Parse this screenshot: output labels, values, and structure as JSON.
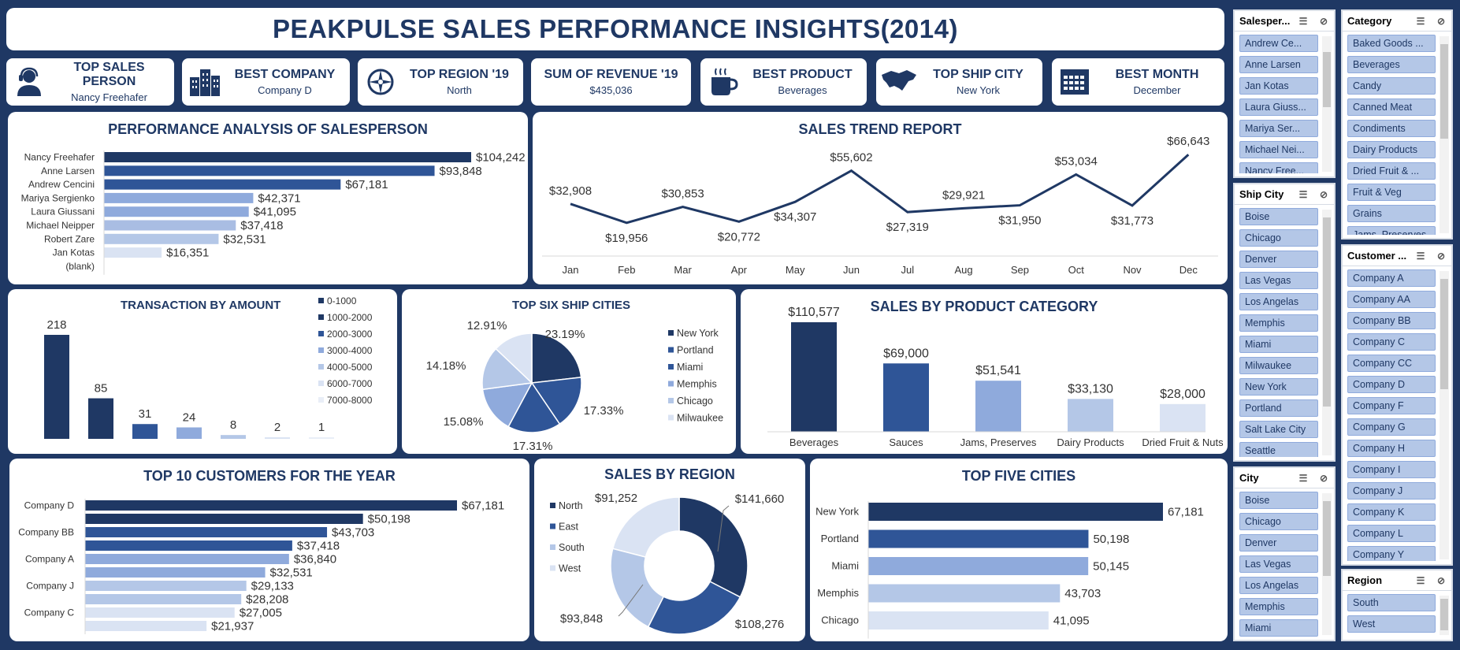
{
  "title": "PEAKPULSE SALES PERFORMANCE INSIGHTS(2014)",
  "kpis": [
    {
      "label": "TOP SALES PERSON",
      "value": "Nancy Freehafer",
      "icon": "person-headset-icon"
    },
    {
      "label": "BEST COMPANY",
      "value": "Company D",
      "icon": "buildings-icon"
    },
    {
      "label": "TOP REGION '19",
      "value": "North",
      "icon": "compass-icon"
    },
    {
      "label": "SUM OF REVENUE '19",
      "value": "$435,036",
      "icon": ""
    },
    {
      "label": "BEST PRODUCT",
      "value": "Beverages",
      "icon": "coffee-cup-icon"
    },
    {
      "label": "TOP SHIP CITY",
      "value": "New York",
      "icon": "map-icon"
    },
    {
      "label": "BEST MONTH",
      "value": "December",
      "icon": "calendar-icon"
    }
  ],
  "panels": {
    "salesperson": "PERFORMANCE ANALYSIS OF SALESPERSON",
    "trend": "SALES TREND REPORT",
    "transaction": "TRANSACTION BY AMOUNT",
    "ship": "TOP SIX SHIP CITIES",
    "category": "SALES BY PRODUCT CATEGORY",
    "customers": "TOP 10 CUSTOMERS FOR THE YEAR",
    "region": "SALES BY REGION",
    "cities": "TOP FIVE CITIES"
  },
  "colors": {
    "navy": "#1f3864",
    "blue": "#2f5597",
    "mid": "#8faadc",
    "light": "#b4c7e7",
    "pale": "#dae3f3",
    "bg": "#1f3864"
  },
  "chart_data": [
    {
      "id": "salesperson",
      "type": "bar",
      "orientation": "horizontal",
      "categories": [
        "Nancy Freehafer",
        "Anne Larsen",
        "Andrew Cencini",
        "Mariya Sergienko",
        "Laura Giussani",
        "Michael Neipper",
        "Robert Zare",
        "Jan Kotas",
        "(blank)"
      ],
      "values": [
        104242,
        93848,
        67181,
        42371,
        41095,
        37418,
        32531,
        16351,
        null
      ],
      "labels": [
        "$104,242",
        "$93,848",
        "$67,181",
        "$42,371",
        "$41,095",
        "$37,418",
        "$32,531",
        "$16,351",
        ""
      ],
      "colors": [
        "#1f3864",
        "#2f5597",
        "#2f5597",
        "#8faadc",
        "#8faadc",
        "#a9bde3",
        "#b4c7e7",
        "#dae3f3",
        "#ffffff"
      ]
    },
    {
      "id": "trend",
      "type": "line",
      "categories": [
        "Jan",
        "Feb",
        "Mar",
        "Apr",
        "May",
        "Jun",
        "Jul",
        "Aug",
        "Sep",
        "Oct",
        "Nov",
        "Dec"
      ],
      "values": [
        32908,
        19956,
        30853,
        20772,
        34307,
        55602,
        27319,
        29921,
        31950,
        53034,
        31773,
        66643
      ],
      "labels": [
        "$32,908",
        "$19,956",
        "$30,853",
        "$20,772",
        "$34,307",
        "$55,602",
        "$27,319",
        "$29,921",
        "$31,950",
        "$53,034",
        "$31,773",
        "$66,643"
      ],
      "label_pos": [
        "above",
        "below",
        "above",
        "below",
        "below",
        "above",
        "below",
        "above",
        "below",
        "above",
        "below",
        "above"
      ]
    },
    {
      "id": "transaction",
      "type": "bar",
      "categories": [
        "0-1000",
        "1000-2000",
        "2000-3000",
        "3000-4000",
        "4000-5000",
        "6000-7000",
        "7000-8000"
      ],
      "values": [
        218,
        85,
        31,
        24,
        8,
        2,
        1
      ],
      "colors": [
        "#1f3864",
        "#1f3864",
        "#2f5597",
        "#8faadc",
        "#b4c7e7",
        "#dae3f3",
        "#e9eef7"
      ],
      "legend": [
        "0-1000",
        "1000-2000",
        "2000-3000",
        "3000-4000",
        "4000-5000",
        "6000-7000",
        "7000-8000"
      ]
    },
    {
      "id": "ship",
      "type": "pie",
      "labels": [
        "New York",
        "Portland",
        "Miami",
        "Memphis",
        "Chicago",
        "Milwaukee"
      ],
      "values": [
        23.19,
        17.33,
        17.31,
        15.08,
        14.18,
        12.91
      ],
      "value_labels": [
        "23.19%",
        "17.33%",
        "17.31%",
        "15.08%",
        "14.18%",
        "12.91%"
      ],
      "colors": [
        "#1f3864",
        "#2f5597",
        "#2f5597",
        "#8faadc",
        "#b4c7e7",
        "#dae3f3"
      ]
    },
    {
      "id": "category",
      "type": "bar",
      "categories": [
        "Beverages",
        "Sauces",
        "Jams, Preserves",
        "Dairy Products",
        "Dried Fruit & Nuts"
      ],
      "values": [
        110577,
        69000,
        51541,
        33130,
        28000
      ],
      "labels": [
        "$110,577",
        "$69,000",
        "$51,541",
        "$33,130",
        "$28,000"
      ],
      "colors": [
        "#1f3864",
        "#2f5597",
        "#8faadc",
        "#b4c7e7",
        "#dae3f3"
      ]
    },
    {
      "id": "customers",
      "type": "bar",
      "orientation": "horizontal",
      "categories": [
        "Company D",
        "",
        "Company BB",
        "",
        "Company A",
        "",
        "Company J",
        "",
        "Company C",
        ""
      ],
      "values": [
        67181,
        50198,
        43703,
        37418,
        36840,
        32531,
        29133,
        28208,
        27005,
        21937
      ],
      "labels": [
        "$67,181",
        "$50,198",
        "$43,703",
        "$37,418",
        "$36,840",
        "$32,531",
        "$29,133",
        "$28,208",
        "$27,005",
        "$21,937"
      ],
      "colors": [
        "#1f3864",
        "#1f3864",
        "#2f5597",
        "#2f5597",
        "#8faadc",
        "#8faadc",
        "#b4c7e7",
        "#b4c7e7",
        "#dae3f3",
        "#dae3f3"
      ]
    },
    {
      "id": "region",
      "type": "pie",
      "donut": true,
      "labels": [
        "North",
        "East",
        "South",
        "West"
      ],
      "values": [
        141660,
        108276,
        93848,
        91252
      ],
      "value_labels": [
        "$141,660",
        "$108,276",
        "$93,848",
        "$91,252"
      ],
      "colors": [
        "#1f3864",
        "#2f5597",
        "#b4c7e7",
        "#dae3f3"
      ]
    },
    {
      "id": "cities",
      "type": "bar",
      "orientation": "horizontal",
      "categories": [
        "New York",
        "Portland",
        "Miami",
        "Memphis",
        "Chicago"
      ],
      "values": [
        67181,
        50198,
        50145,
        43703,
        41095
      ],
      "labels": [
        "67,181",
        "50,198",
        "50,145",
        "43,703",
        "41,095"
      ],
      "colors": [
        "#1f3864",
        "#2f5597",
        "#8faadc",
        "#b4c7e7",
        "#dae3f3"
      ]
    }
  ],
  "slicers": [
    {
      "name": "Salesper...",
      "items": [
        "Andrew Ce...",
        "Anne Larsen",
        "Jan Kotas",
        "Laura Giuss...",
        "Mariya Ser...",
        "Michael Nei...",
        "Nancy Free..."
      ]
    },
    {
      "name": "Ship City",
      "items": [
        "Boise",
        "Chicago",
        "Denver",
        "Las Vegas",
        "Los Angelas",
        "Memphis",
        "Miami",
        "Milwaukee",
        "New York",
        "Portland",
        "Salt Lake City",
        "Seattle"
      ]
    },
    {
      "name": "City",
      "items": [
        "Boise",
        "Chicago",
        "Denver",
        "Las Vegas",
        "Los Angelas",
        "Memphis",
        "Miami"
      ]
    },
    {
      "name": "Category",
      "items": [
        "Baked Goods ...",
        "Beverages",
        "Candy",
        "Canned Meat",
        "Condiments",
        "Dairy Products",
        "Dried Fruit & ...",
        "Fruit & Veg",
        "Grains",
        "Jams, Preserves"
      ]
    },
    {
      "name": "Customer ...",
      "items": [
        "Company A",
        "Company AA",
        "Company BB",
        "Company C",
        "Company CC",
        "Company D",
        "Company F",
        "Company G",
        "Company H",
        "Company I",
        "Company J",
        "Company K",
        "Company L",
        "Company Y"
      ]
    },
    {
      "name": "Region",
      "items": [
        "South",
        "West"
      ]
    }
  ]
}
